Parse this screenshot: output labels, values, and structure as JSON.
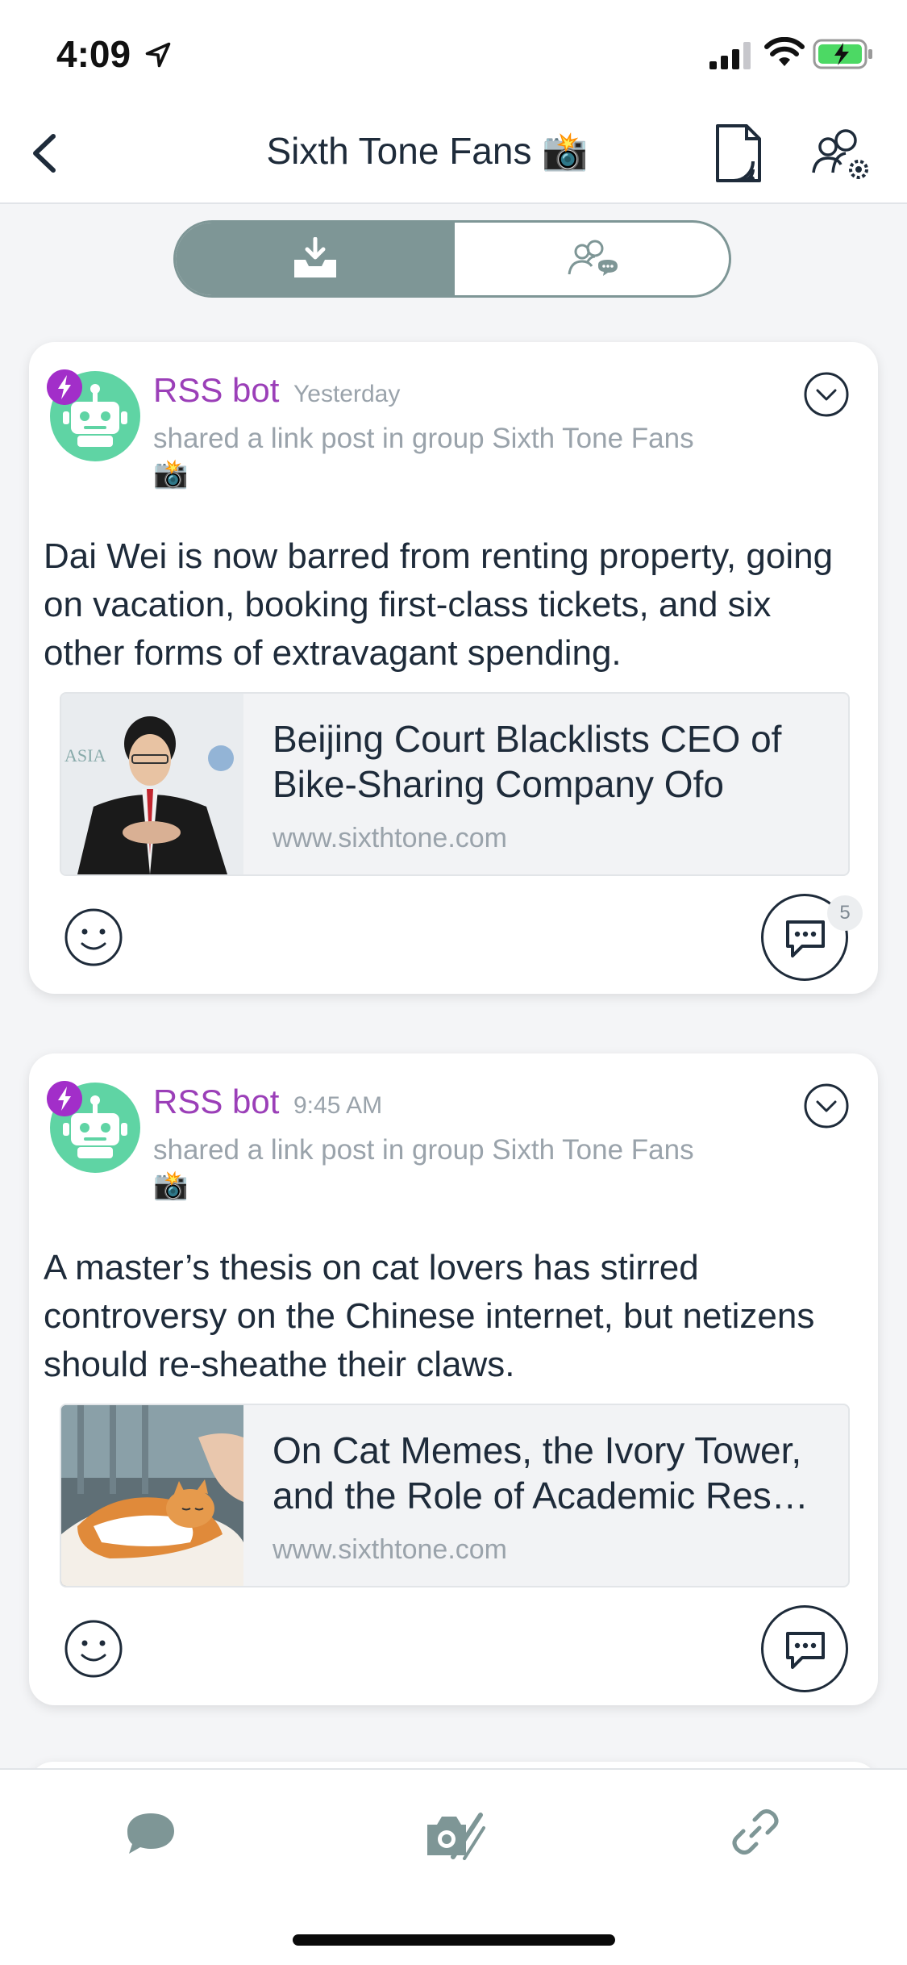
{
  "status_bar": {
    "time": "4:09"
  },
  "header": {
    "title": "Sixth Tone Fans 📸"
  },
  "posts": [
    {
      "author": "RSS bot",
      "timestamp": "Yesterday",
      "action_line": "shared a link post in group Sixth Tone Fans",
      "group_emoji": "📸",
      "text": "Dai Wei is now barred from renting property, going on vacation, booking first-class tickets, and six other forms of extravagant spending.",
      "link": {
        "title": "Beijing Court Blacklists CEO of Bike-Sharing Company Ofo",
        "domain": "www.sixthtone.com"
      },
      "comment_count": "5"
    },
    {
      "author": "RSS bot",
      "timestamp": "9:45 AM",
      "action_line": "shared a link post in group Sixth Tone Fans",
      "group_emoji": "📸",
      "text": "A master’s thesis on cat lovers has stirred controversy on the Chinese internet, but netizens should re-sheathe their claws.",
      "link": {
        "title": "On Cat Memes, the Ivory Tower, and the Role of Academic Res…",
        "domain": "www.sixthtone.com"
      },
      "comment_count": ""
    }
  ],
  "icons": {
    "avatar": "robot-avatar-icon",
    "badge": "lightning-badge-icon",
    "menu": "chevron-down-circle-icon",
    "react": "smiley-icon",
    "comment": "comment-bubble-icon",
    "tab_chat": "chat-bubble-icon",
    "tab_camera": "camera-icon",
    "tab_link": "link-icon"
  },
  "colors": {
    "accent": "#7e9696",
    "author": "#9b3fb8",
    "text": "#1e2b3a",
    "muted": "#9aa3ab",
    "bot_avatar": "#5fd4a4"
  }
}
